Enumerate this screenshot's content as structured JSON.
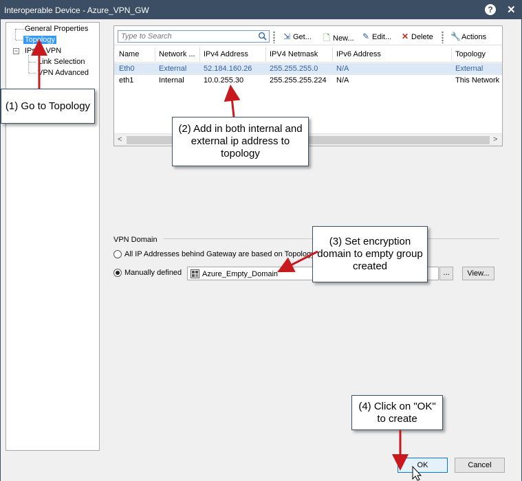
{
  "window": {
    "title": "Interoperable Device - Azure_VPN_GW",
    "help_label": "?",
    "close_label": "✕"
  },
  "tree": {
    "items": [
      {
        "label": "General Properties"
      },
      {
        "label": "Topology",
        "selected": true
      },
      {
        "label": "IPsec VPN"
      },
      {
        "label": "Link Selection"
      },
      {
        "label": "VPN Advanced"
      }
    ]
  },
  "toolbar": {
    "search_placeholder": "Type to Search",
    "get_label": "Get...",
    "new_label": "New...",
    "edit_label": "Edit...",
    "delete_label": "Delete",
    "actions_label": "Actions"
  },
  "table": {
    "columns": [
      "Name",
      "Network ...",
      "IPv4 Address",
      "IPV4 Netmask",
      "IPv6 Address",
      "Topology"
    ],
    "rows": [
      {
        "name": "Eth0",
        "network": "External",
        "ipv4": "52.184.160.26",
        "netmask": "255.255.255.0",
        "ipv6": "N/A",
        "topology": "External"
      },
      {
        "name": "eth1",
        "network": "Internal",
        "ipv4": "10.0.255.30",
        "netmask": "255.255.255.224",
        "ipv6": "N/A",
        "topology": "This Network"
      }
    ]
  },
  "vpn_domain": {
    "section_label": "VPN Domain",
    "option_topology": "All IP Addresses behind Gateway are based on Topology i",
    "option_manual": "Manually defined",
    "selected_group": "Azure_Empty_Domain",
    "browse_label": "...",
    "view_label": "View..."
  },
  "buttons": {
    "ok_label": "OK",
    "cancel_label": "Cancel"
  },
  "callouts": {
    "step1": "(1) Go to Topology",
    "step2": "(2) Add in both internal and external ip address to topology",
    "step3": "(3) Set encryption domain to empty group created",
    "step4": "(4) Click on \"OK\" to create"
  },
  "colors": {
    "titlebar": "#3c4e63",
    "selection": "#3399ff",
    "row_selected_text": "#2f5fa5",
    "annotation_arrow": "#c8191f"
  }
}
